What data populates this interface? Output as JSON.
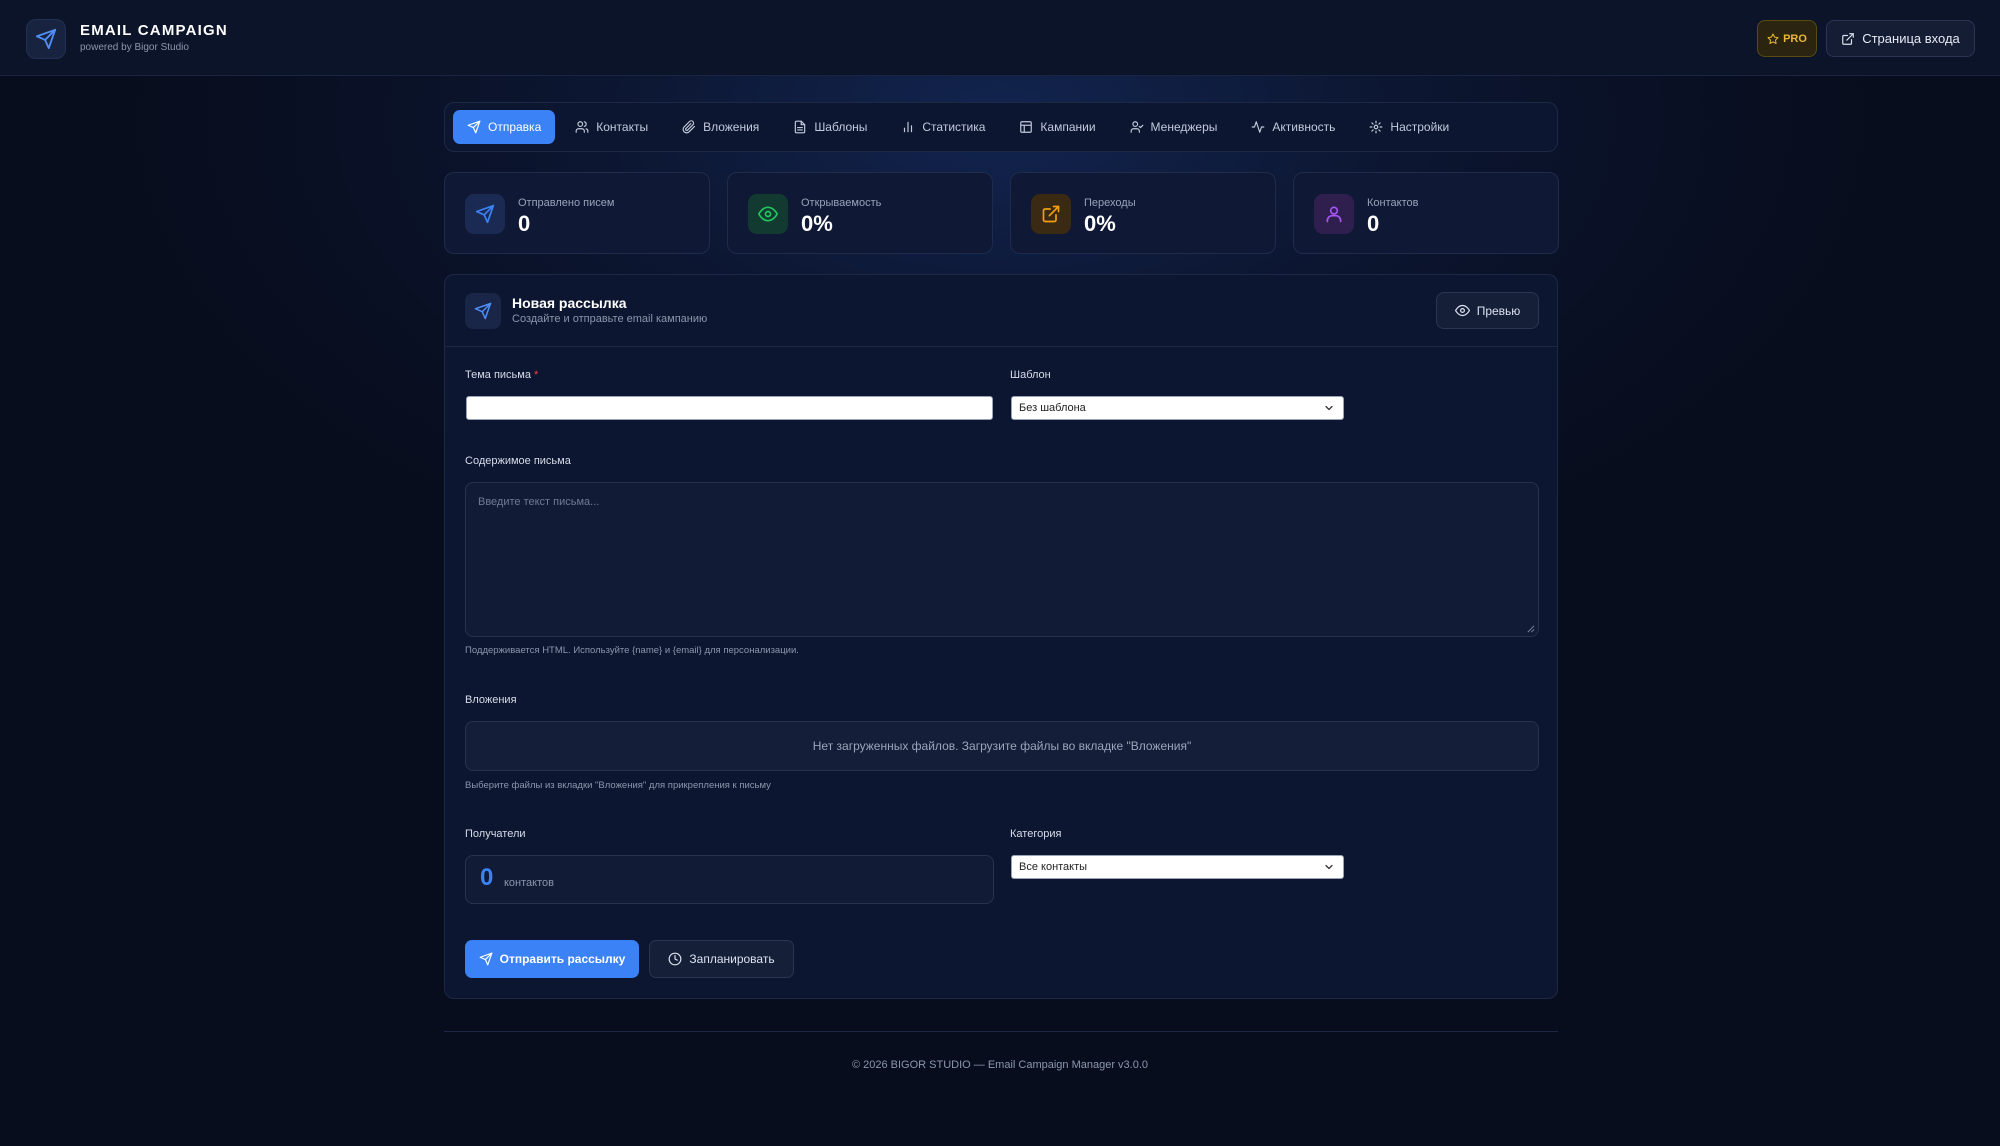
{
  "header": {
    "title": "EMAIL CAMPAIGN",
    "subtitle": "powered by Bigor Studio",
    "pro_label": "PRO",
    "login_label": "Страница входа"
  },
  "tabs": [
    {
      "label": "Отправка",
      "icon": "send-icon",
      "active": true
    },
    {
      "label": "Контакты",
      "icon": "users-icon"
    },
    {
      "label": "Вложения",
      "icon": "paperclip-icon"
    },
    {
      "label": "Шаблоны",
      "icon": "document-icon"
    },
    {
      "label": "Статистика",
      "icon": "bar-chart-icon"
    },
    {
      "label": "Кампании",
      "icon": "table-icon"
    },
    {
      "label": "Менеджеры",
      "icon": "user-check-icon"
    },
    {
      "label": "Активность",
      "icon": "activity-icon"
    },
    {
      "label": "Настройки",
      "icon": "gear-icon"
    }
  ],
  "stats": [
    {
      "label": "Отправлено писем",
      "value": "0",
      "icon": "send-icon",
      "color": "#3b82f6"
    },
    {
      "label": "Открываемость",
      "value": "0%",
      "icon": "eye-icon",
      "color": "#22c55e"
    },
    {
      "label": "Переходы",
      "value": "0%",
      "icon": "external-link-icon",
      "color": "#f59e0b"
    },
    {
      "label": "Контактов",
      "value": "0",
      "icon": "user-icon",
      "color": "#a855f7"
    }
  ],
  "form": {
    "title": "Новая рассылка",
    "subtitle": "Создайте и отправьте email кампанию",
    "preview_label": "Превью",
    "subject_label": "Тема письма",
    "subject_required": "*",
    "subject_value": "",
    "template_label": "Шаблон",
    "template_value": "Без шаблона",
    "content_label": "Содержимое письма",
    "content_placeholder": "Введите текст письма...",
    "content_hint": "Поддерживается HTML. Используйте {name} и {email} для персонализации.",
    "attachments_label": "Вложения",
    "attachments_empty": "Нет загруженных файлов. Загрузите файлы во вкладке \"Вложения\"",
    "attachments_hint": "Выберите файлы из вкладки \"Вложения\" для прикрепления к письму",
    "recipients_label": "Получатели",
    "recipients_count": "0",
    "recipients_unit": "контактов",
    "category_label": "Категория",
    "category_value": "Все контакты",
    "send_label": "Отправить рассылку",
    "schedule_label": "Запланировать"
  },
  "footer": {
    "text": "© 2026 BIGOR STUDIO — Email Campaign Manager v3.0.0"
  },
  "colors": {
    "accent": "#3b82f6",
    "background": "#0b1226",
    "pro": "#e9b637"
  }
}
